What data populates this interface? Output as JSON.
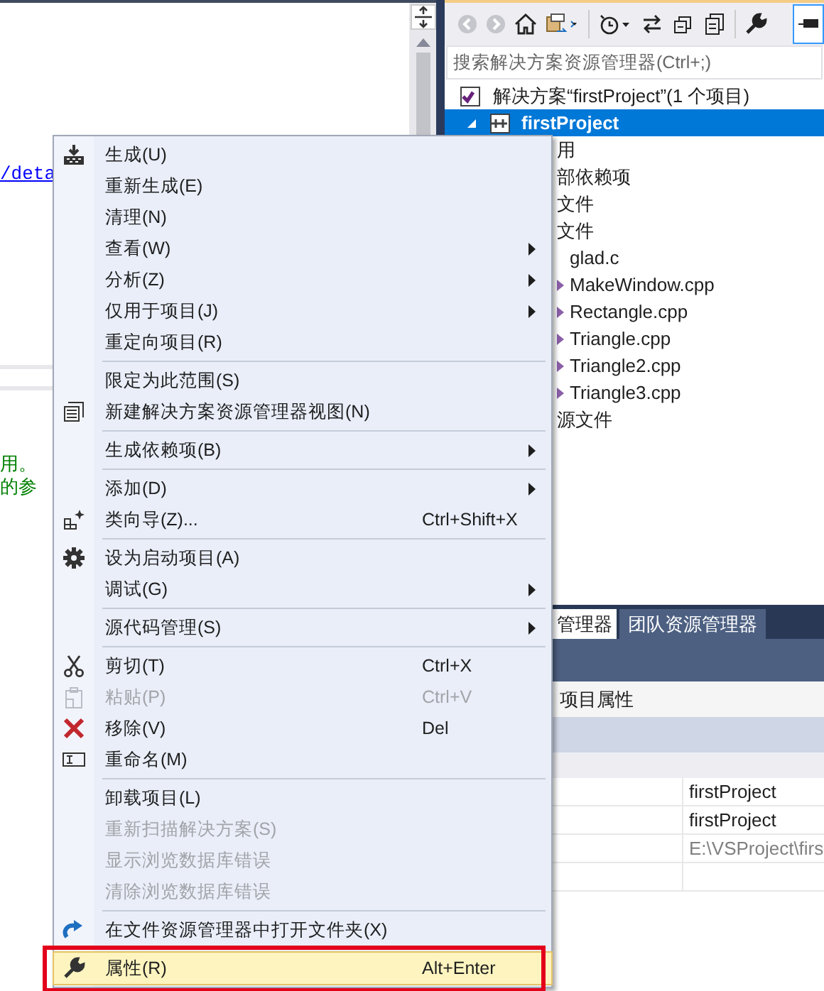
{
  "editor": {
    "link": "/deta",
    "comment_lines": [
      "用。",
      "的参"
    ]
  },
  "solution_explorer": {
    "search": {
      "placeholder": "搜索解决方案资源管理器(Ctrl+;)"
    },
    "tree": [
      {
        "label": "解决方案“firstProject”(1 个项目)",
        "selected": false
      },
      {
        "label": "firstProject",
        "selected": true,
        "expanded": true,
        "children": [
          {
            "label": "用",
            "selected": false
          },
          {
            "label": "部依赖项",
            "selected": false
          },
          {
            "label": "文件",
            "selected": false
          },
          {
            "label": "文件",
            "selected": false,
            "children": [
              {
                "label": "glad.c",
                "selected": false
              },
              {
                "label": "MakeWindow.cpp",
                "selected": false,
                "expanded": false
              },
              {
                "label": "Rectangle.cpp",
                "selected": false,
                "expanded": false
              },
              {
                "label": "Triangle.cpp",
                "selected": false,
                "expanded": false
              },
              {
                "label": "Triangle2.cpp",
                "selected": false,
                "expanded": false
              },
              {
                "label": "Triangle3.cpp",
                "selected": false,
                "expanded": false
              }
            ]
          },
          {
            "label": "源文件",
            "selected": false
          }
        ]
      }
    ]
  },
  "tabs": [
    {
      "label": "管理器",
      "selected": true
    },
    {
      "label": "团队资源管理器",
      "selected": false
    }
  ],
  "properties": {
    "title": "项目属性",
    "rows": [
      {
        "value": "firstProject",
        "readonly": false
      },
      {
        "value": "firstProject",
        "readonly": false
      },
      {
        "value": "E:\\VSProject\\firs",
        "readonly": true
      }
    ]
  },
  "context_menu": {
    "groups": [
      {
        "items": [
          {
            "label": "生成(U)",
            "submenu": false,
            "disabled": false,
            "selected": false
          },
          {
            "label": "重新生成(E)",
            "submenu": false,
            "disabled": false,
            "selected": false
          },
          {
            "label": "清理(N)",
            "submenu": false,
            "disabled": false,
            "selected": false
          },
          {
            "label": "查看(W)",
            "submenu": true,
            "disabled": false,
            "selected": false
          },
          {
            "label": "分析(Z)",
            "submenu": true,
            "disabled": false,
            "selected": false
          },
          {
            "label": "仅用于项目(J)",
            "submenu": true,
            "disabled": false,
            "selected": false
          },
          {
            "label": "重定向项目(R)",
            "submenu": false,
            "disabled": false,
            "selected": false
          }
        ]
      },
      {
        "items": [
          {
            "label": "限定为此范围(S)",
            "submenu": false,
            "disabled": false,
            "selected": false
          },
          {
            "label": "新建解决方案资源管理器视图(N)",
            "submenu": false,
            "disabled": false,
            "selected": false
          }
        ]
      },
      {
        "items": [
          {
            "label": "生成依赖项(B)",
            "submenu": true,
            "disabled": false,
            "selected": false
          }
        ]
      },
      {
        "items": [
          {
            "label": "添加(D)",
            "submenu": true,
            "disabled": false,
            "selected": false
          },
          {
            "label": "类向导(Z)...",
            "shortcut": "Ctrl+Shift+X",
            "submenu": false,
            "disabled": false,
            "selected": false
          }
        ]
      },
      {
        "items": [
          {
            "label": "设为启动项目(A)",
            "submenu": false,
            "disabled": false,
            "selected": false
          },
          {
            "label": "调试(G)",
            "submenu": true,
            "disabled": false,
            "selected": false
          }
        ]
      },
      {
        "items": [
          {
            "label": "源代码管理(S)",
            "submenu": true,
            "disabled": false,
            "selected": false
          }
        ]
      },
      {
        "items": [
          {
            "label": "剪切(T)",
            "shortcut": "Ctrl+X",
            "submenu": false,
            "disabled": false,
            "selected": false
          },
          {
            "label": "粘贴(P)",
            "shortcut": "Ctrl+V",
            "submenu": false,
            "disabled": true,
            "selected": false
          },
          {
            "label": "移除(V)",
            "shortcut": "Del",
            "submenu": false,
            "disabled": false,
            "selected": false
          },
          {
            "label": "重命名(M)",
            "submenu": false,
            "disabled": false,
            "selected": false
          }
        ]
      },
      {
        "items": [
          {
            "label": "卸载项目(L)",
            "submenu": false,
            "disabled": false,
            "selected": false
          },
          {
            "label": "重新扫描解决方案(S)",
            "submenu": false,
            "disabled": true,
            "selected": false
          },
          {
            "label": "显示浏览数据库错误",
            "submenu": false,
            "disabled": true,
            "selected": false
          },
          {
            "label": "清除浏览数据库错误",
            "submenu": false,
            "disabled": true,
            "selected": false
          }
        ]
      },
      {
        "items": [
          {
            "label": "在文件资源管理器中打开文件夹(X)",
            "submenu": false,
            "disabled": false,
            "selected": false
          }
        ]
      },
      {
        "items": [
          {
            "label": "属性(R)",
            "shortcut": "Alt+Enter",
            "submenu": false,
            "disabled": false,
            "selected": true,
            "annotated": true
          }
        ]
      }
    ]
  }
}
